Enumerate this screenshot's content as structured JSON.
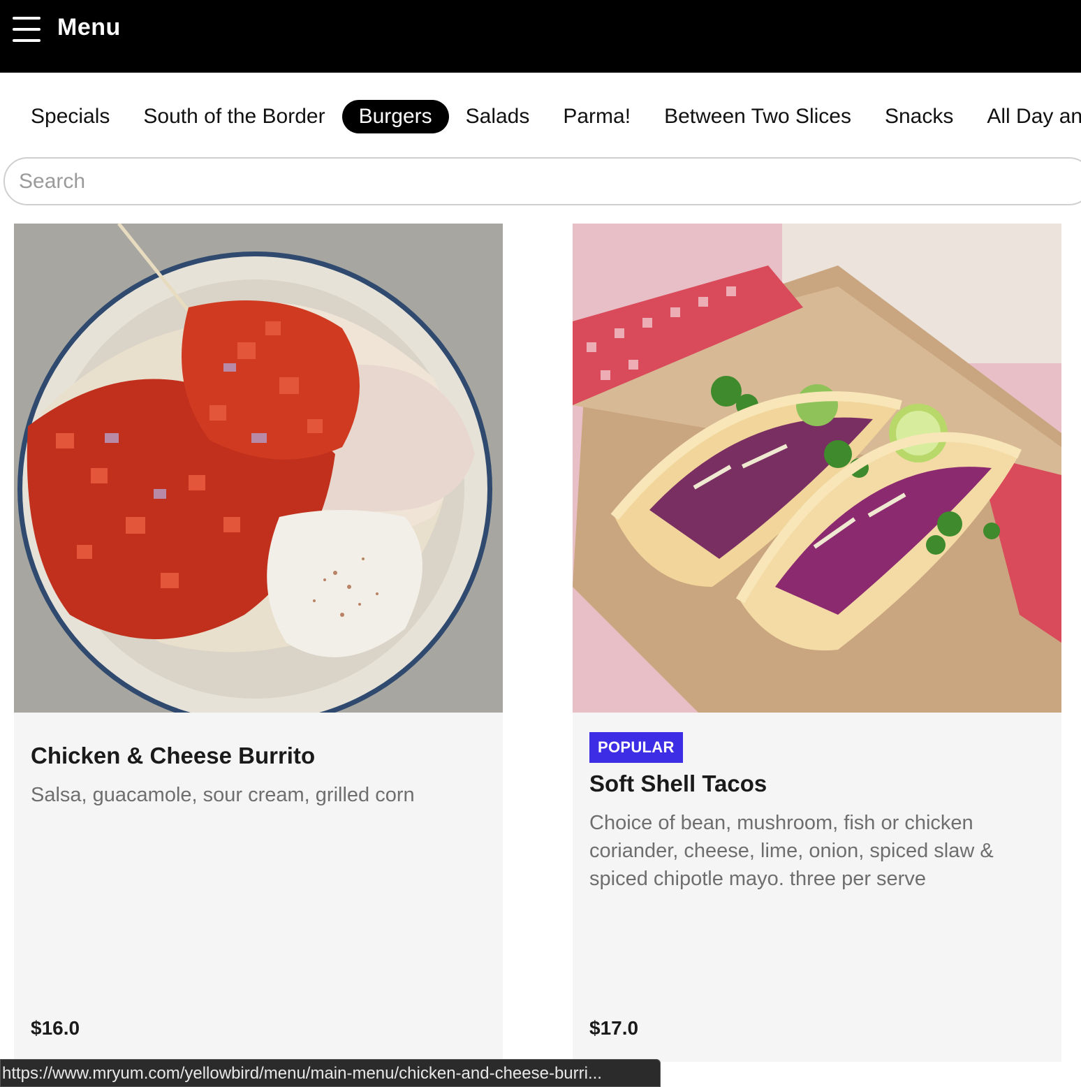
{
  "header": {
    "menu_icon": "hamburger-icon",
    "title": "Menu",
    "background": "#000000"
  },
  "tabs": [
    {
      "label": "Specials",
      "active": false
    },
    {
      "label": "South of the Border",
      "active": false
    },
    {
      "label": "Burgers",
      "active": true
    },
    {
      "label": "Salads",
      "active": false
    },
    {
      "label": "Parma!",
      "active": false
    },
    {
      "label": "Between Two Slices",
      "active": false
    },
    {
      "label": "Snacks",
      "active": false
    },
    {
      "label": "All Day an",
      "active": false
    }
  ],
  "search": {
    "placeholder": "Search",
    "value": ""
  },
  "items": [
    {
      "image": "burrito-photo",
      "badge": "",
      "name": "Chicken & Cheese Burrito",
      "description": "Salsa, guacamole, sour cream, grilled corn",
      "price": "$16.0"
    },
    {
      "image": "tacos-photo",
      "badge": "POPULAR",
      "name": "Soft Shell Tacos",
      "description": "Choice of bean, mushroom, fish or chicken coriander, cheese, lime, onion, spiced slaw & spiced chipotle mayo. three per serve",
      "price": "$17.0"
    }
  ],
  "colors": {
    "badge": "#3d2ee6",
    "active_tab": "#000000",
    "card_bg": "#f5f5f5"
  },
  "status_bar": {
    "url": "https://www.mryum.com/yellowbird/menu/main-menu/chicken-and-cheese-burri..."
  }
}
